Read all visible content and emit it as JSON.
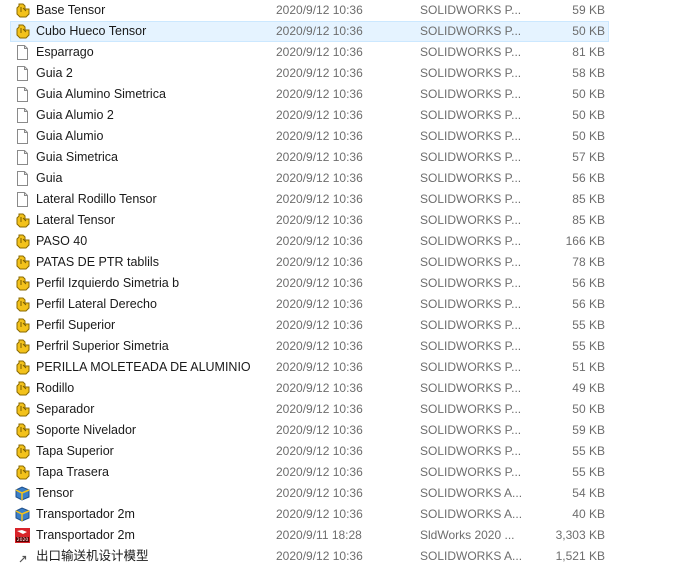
{
  "files": [
    {
      "name": "Base Tensor",
      "date": "2020/9/12 10:36",
      "type": "SOLIDWORKS P...",
      "size": "59 KB",
      "icon": "solidworks-part-icon",
      "selected": false
    },
    {
      "name": "Cubo Hueco Tensor",
      "date": "2020/9/12 10:36",
      "type": "SOLIDWORKS P...",
      "size": "50 KB",
      "icon": "solidworks-part-icon",
      "selected": true
    },
    {
      "name": "Esparrago",
      "date": "2020/9/12 10:36",
      "type": "SOLIDWORKS P...",
      "size": "81 KB",
      "icon": "blank-file-icon",
      "selected": false
    },
    {
      "name": "Guia 2",
      "date": "2020/9/12 10:36",
      "type": "SOLIDWORKS P...",
      "size": "58 KB",
      "icon": "blank-file-icon",
      "selected": false
    },
    {
      "name": "Guia Alumino Simetrica",
      "date": "2020/9/12 10:36",
      "type": "SOLIDWORKS P...",
      "size": "50 KB",
      "icon": "blank-file-icon",
      "selected": false
    },
    {
      "name": "Guia Alumio 2",
      "date": "2020/9/12 10:36",
      "type": "SOLIDWORKS P...",
      "size": "50 KB",
      "icon": "blank-file-icon",
      "selected": false
    },
    {
      "name": "Guia Alumio",
      "date": "2020/9/12 10:36",
      "type": "SOLIDWORKS P...",
      "size": "50 KB",
      "icon": "blank-file-icon",
      "selected": false
    },
    {
      "name": "Guia Simetrica",
      "date": "2020/9/12 10:36",
      "type": "SOLIDWORKS P...",
      "size": "57 KB",
      "icon": "blank-file-icon",
      "selected": false
    },
    {
      "name": "Guia",
      "date": "2020/9/12 10:36",
      "type": "SOLIDWORKS P...",
      "size": "56 KB",
      "icon": "blank-file-icon",
      "selected": false
    },
    {
      "name": "Lateral Rodillo Tensor",
      "date": "2020/9/12 10:36",
      "type": "SOLIDWORKS P...",
      "size": "85 KB",
      "icon": "blank-file-icon",
      "selected": false
    },
    {
      "name": "Lateral Tensor",
      "date": "2020/9/12 10:36",
      "type": "SOLIDWORKS P...",
      "size": "85 KB",
      "icon": "solidworks-part-icon",
      "selected": false
    },
    {
      "name": "PASO 40",
      "date": "2020/9/12 10:36",
      "type": "SOLIDWORKS P...",
      "size": "166 KB",
      "icon": "solidworks-part-icon",
      "selected": false
    },
    {
      "name": "PATAS DE PTR tablils",
      "date": "2020/9/12 10:36",
      "type": "SOLIDWORKS P...",
      "size": "78 KB",
      "icon": "solidworks-part-icon",
      "selected": false
    },
    {
      "name": "Perfil Izquierdo Simetria b",
      "date": "2020/9/12 10:36",
      "type": "SOLIDWORKS P...",
      "size": "56 KB",
      "icon": "solidworks-part-icon",
      "selected": false
    },
    {
      "name": "Perfil Lateral Derecho",
      "date": "2020/9/12 10:36",
      "type": "SOLIDWORKS P...",
      "size": "56 KB",
      "icon": "solidworks-part-icon",
      "selected": false
    },
    {
      "name": "Perfil Superior",
      "date": "2020/9/12 10:36",
      "type": "SOLIDWORKS P...",
      "size": "55 KB",
      "icon": "solidworks-part-icon",
      "selected": false
    },
    {
      "name": "Perfril Superior Simetria",
      "date": "2020/9/12 10:36",
      "type": "SOLIDWORKS P...",
      "size": "55 KB",
      "icon": "solidworks-part-icon",
      "selected": false
    },
    {
      "name": "PERILLA MOLETEADA DE ALUMINIO",
      "date": "2020/9/12 10:36",
      "type": "SOLIDWORKS P...",
      "size": "51 KB",
      "icon": "solidworks-part-icon",
      "selected": false
    },
    {
      "name": "Rodillo",
      "date": "2020/9/12 10:36",
      "type": "SOLIDWORKS P...",
      "size": "49 KB",
      "icon": "solidworks-part-icon",
      "selected": false
    },
    {
      "name": "Separador",
      "date": "2020/9/12 10:36",
      "type": "SOLIDWORKS P...",
      "size": "50 KB",
      "icon": "solidworks-part-icon",
      "selected": false
    },
    {
      "name": "Soporte Nivelador",
      "date": "2020/9/12 10:36",
      "type": "SOLIDWORKS P...",
      "size": "59 KB",
      "icon": "solidworks-part-icon",
      "selected": false
    },
    {
      "name": "Tapa Superior",
      "date": "2020/9/12 10:36",
      "type": "SOLIDWORKS P...",
      "size": "55 KB",
      "icon": "solidworks-part-icon",
      "selected": false
    },
    {
      "name": "Tapa Trasera",
      "date": "2020/9/12 10:36",
      "type": "SOLIDWORKS P...",
      "size": "55 KB",
      "icon": "solidworks-part-icon",
      "selected": false
    },
    {
      "name": "Tensor",
      "date": "2020/9/12 10:36",
      "type": "SOLIDWORKS A...",
      "size": "54 KB",
      "icon": "solidworks-assembly-icon",
      "selected": false
    },
    {
      "name": "Transportador 2m",
      "date": "2020/9/12 10:36",
      "type": "SOLIDWORKS A...",
      "size": "40 KB",
      "icon": "solidworks-assembly-icon",
      "selected": false
    },
    {
      "name": "Transportador 2m",
      "date": "2020/9/11 18:28",
      "type": "SldWorks 2020 ...",
      "size": "3,303 KB",
      "icon": "sldworks-2020-icon",
      "selected": false
    },
    {
      "name": "出口输送机设计模型",
      "date": "2020/9/12 10:36",
      "type": "SOLIDWORKS A...",
      "size": "1,521 KB",
      "icon": "shortcut-icon",
      "selected": false
    }
  ],
  "icon_labels": {
    "sldworks_badge": "2020"
  },
  "colors": {
    "selection_bg": "#e5f3ff",
    "selection_border": "#cce8ff",
    "part_icon_yellow": "#f3c21b",
    "assembly_icon_blue": "#3b7fc9",
    "sldworks_red": "#d8242a",
    "muted_text": "#6d6d6d"
  }
}
